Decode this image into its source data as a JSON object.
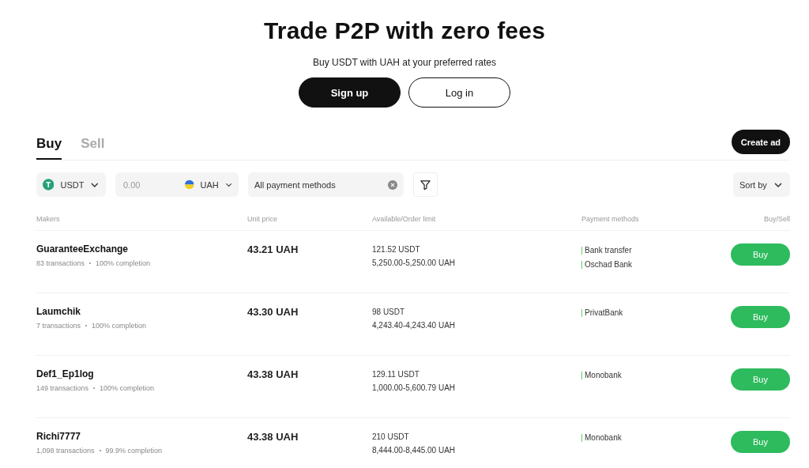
{
  "hero": {
    "title": "Trade P2P with zero fees",
    "subtitle": "Buy USDT with UAH at your preferred rates",
    "buttons": [
      {
        "label": "Sign up",
        "kind": "primary"
      },
      {
        "label": "Log in",
        "kind": "outline"
      }
    ]
  },
  "tabs": [
    {
      "label": "Buy",
      "selected": true
    },
    {
      "label": "Sell",
      "selected": false
    }
  ],
  "create_button": "Create ad",
  "filters": {
    "coin": "USDT",
    "amount": {
      "placeholder": "0.00"
    },
    "fiat": "UAH",
    "payment": "All payment methods",
    "sort": "Sort by"
  },
  "table": {
    "columns": [
      "Makers",
      "Unit price",
      "Available/Order limit",
      "Payment methods",
      "Buy/Sell"
    ],
    "rows": [
      {
        "maker": "GuaranteeExchange",
        "transactions": "83 transactions",
        "completion": "100% completion",
        "price": "43.21 UAH",
        "available": "121.52 USDT",
        "limit": "5,250.00-5,250.00 UAH",
        "methods": [
          "Bank transfer",
          "Oschad Bank"
        ],
        "action": "Buy"
      },
      {
        "maker": "Laumchik",
        "transactions": "7 transactions",
        "completion": "100% completion",
        "price": "43.30 UAH",
        "available": "98 USDT",
        "limit": "4,243.40-4,243.40 UAH",
        "methods": [
          "PrivatBank"
        ],
        "action": "Buy"
      },
      {
        "maker": "Def1_Ep1log",
        "transactions": "149 transactions",
        "completion": "100% completion",
        "price": "43.38 UAH",
        "available": "129.11 USDT",
        "limit": "1,000.00-5,600.79 UAH",
        "methods": [
          "Monobank"
        ],
        "action": "Buy"
      },
      {
        "maker": "Richi7777",
        "transactions": "1,098 transactions",
        "completion": "99.9% completion",
        "price": "43.38 UAH",
        "available": "210 USDT",
        "limit": "8,444.00-8,445.00 UAH",
        "methods": [
          "Monobank"
        ],
        "action": "Buy"
      }
    ]
  }
}
